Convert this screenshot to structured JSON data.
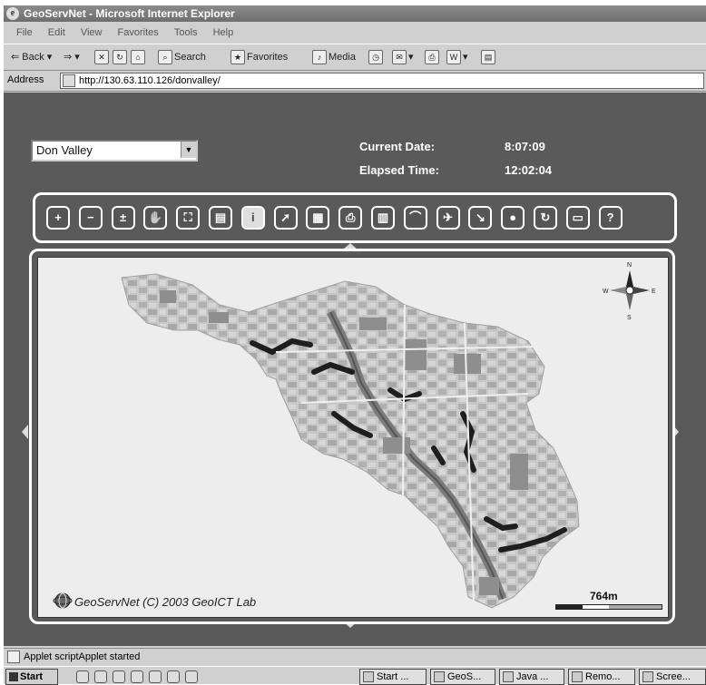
{
  "window": {
    "title": "GeoServNet - Microsoft Internet Explorer"
  },
  "menu": [
    "File",
    "Edit",
    "View",
    "Favorites",
    "Tools",
    "Help"
  ],
  "toolbar": {
    "back": "Back",
    "search": "Search",
    "favorites": "Favorites",
    "media": "Media"
  },
  "address": {
    "label": "Address",
    "url": "http://130.63.110.126/donvalley/"
  },
  "app": {
    "region_select": "Don Valley",
    "current_date_label": "Current Date:",
    "current_date_value": "8:07:09",
    "elapsed_label": "Elapsed Time:",
    "elapsed_value": "12:02:04",
    "tools": [
      {
        "name": "zoom-in",
        "glyph": "+"
      },
      {
        "name": "zoom-out",
        "glyph": "−"
      },
      {
        "name": "zoom-toggle",
        "glyph": "±"
      },
      {
        "name": "pan",
        "glyph": "✋"
      },
      {
        "name": "full-extent",
        "glyph": "⛶"
      },
      {
        "name": "layers",
        "glyph": "▤"
      },
      {
        "name": "info",
        "glyph": "i",
        "active": true
      },
      {
        "name": "select",
        "glyph": "➚"
      },
      {
        "name": "legend",
        "glyph": "▦"
      },
      {
        "name": "print",
        "glyph": "⎙"
      },
      {
        "name": "table",
        "glyph": "▥"
      },
      {
        "name": "terrain",
        "glyph": "⌒"
      },
      {
        "name": "flight",
        "glyph": "✈"
      },
      {
        "name": "measure",
        "glyph": "↘"
      },
      {
        "name": "buffer",
        "glyph": "●"
      },
      {
        "name": "refresh",
        "glyph": "↻"
      },
      {
        "name": "save",
        "glyph": "▭"
      },
      {
        "name": "help",
        "glyph": "?"
      }
    ],
    "map": {
      "compass": {
        "n": "N",
        "e": "E",
        "s": "S",
        "w": "W"
      },
      "copyright": "GeoServNet (C) 2003 GeoICT Lab",
      "scale_label": "764m"
    }
  },
  "status": {
    "text": "Applet scriptApplet started"
  },
  "taskbar": {
    "start": "Start",
    "tasks": [
      "Start ...",
      "GeoS...",
      "Java ...",
      "Remo...",
      "Scree..."
    ]
  }
}
